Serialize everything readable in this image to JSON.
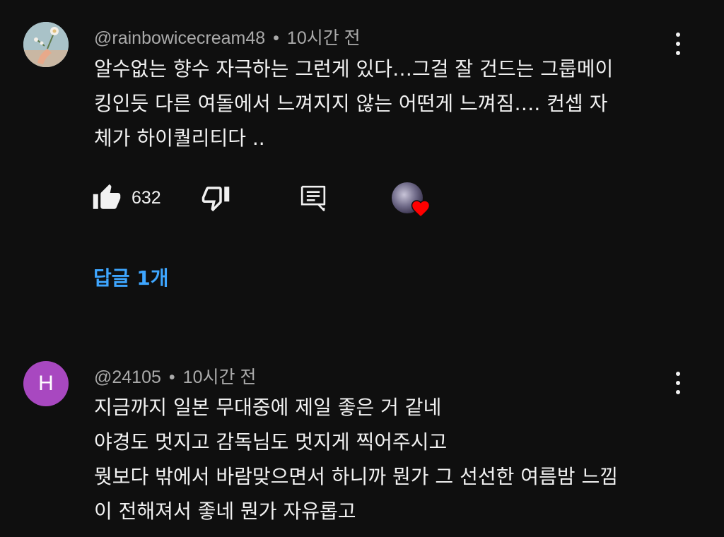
{
  "comments": [
    {
      "handle": "@rainbowicecream48",
      "time": "10시간 전",
      "text": "알수없는 향수 자극하는 그런게 있다…그걸 잘 건드는 그룹메이\n킹인듯 다른 여돌에서 느껴지지 않는 어떤게 느껴짐…. 컨셉 자\n체가 하이퀄리티다 ..",
      "like_count": "632",
      "replies_label": "답글 1개",
      "icons": {
        "like": "thumbs-up-filled-icon",
        "dislike": "thumbs-down-icon",
        "reply": "reply-comment-icon",
        "hearted": "creator-heart-icon",
        "menu": "more-vertical-icon"
      }
    },
    {
      "handle": "@24105",
      "time": "10시간 전",
      "avatar_letter": "H",
      "text": "지금까지 일본 무대중에 제일 좋은 거 같네\n야경도 멋지고 감독님도 멋지게 찍어주시고\n뭣보다 밖에서 바람맞으면서 하니까 뭔가 그 선선한 여름밤 느낌\n이 전해져서 좋네 뭔가 자유롭고"
    }
  ],
  "colors": {
    "background": "#0f0f0f",
    "text": "#f1f1f1",
    "meta_text": "#aaaaaa",
    "link_blue": "#3ea6ff",
    "avatar_purple": "#a848c0",
    "heart_red": "#ff0000"
  }
}
